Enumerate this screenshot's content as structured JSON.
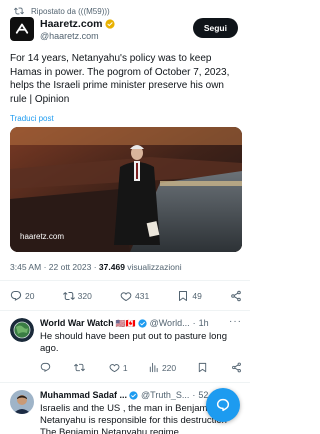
{
  "repost": {
    "label": "Ripostato da (((M59)))"
  },
  "author": {
    "name": "Haaretz.com",
    "handle": "@haaretz.com",
    "follow_label": "Segui"
  },
  "tweet": {
    "text": "For 14 years, Netanyahu's policy was to keep Hamas in power. The pogrom of October 7, 2023, helps the Israeli prime minister preserve his own rule | Opinion",
    "translate_label": "Traduci post",
    "media_watermark": "haaretz.com"
  },
  "meta": {
    "time": "3:45 AM",
    "sep": "·",
    "date": "22 ott 2023",
    "views_count": "37.469",
    "views_label": "visualizzazioni"
  },
  "actions": {
    "replies": "20",
    "reposts": "320",
    "likes": "431",
    "bookmarks": "49"
  },
  "replies": [
    {
      "name": "World War Watch",
      "flags": "🇺🇸🇨🇦",
      "handle": "@World...",
      "time": "1h",
      "text": "He should have been put out to pasture long ago.",
      "replies": "",
      "reposts": "",
      "likes": "1",
      "views": "220"
    },
    {
      "name": "Muhammad Sadaf ...",
      "handle": "@Truth_S...",
      "time": "52...",
      "text": "Israelis and the US , the man in Benjamin Netanyahu is responsible for this destruction The Benjamin Netanyahu regime"
    }
  ],
  "colors": {
    "accent": "#1d9bf0",
    "text": "#0f1419",
    "muted": "#536471",
    "gold": "#e8b100"
  }
}
